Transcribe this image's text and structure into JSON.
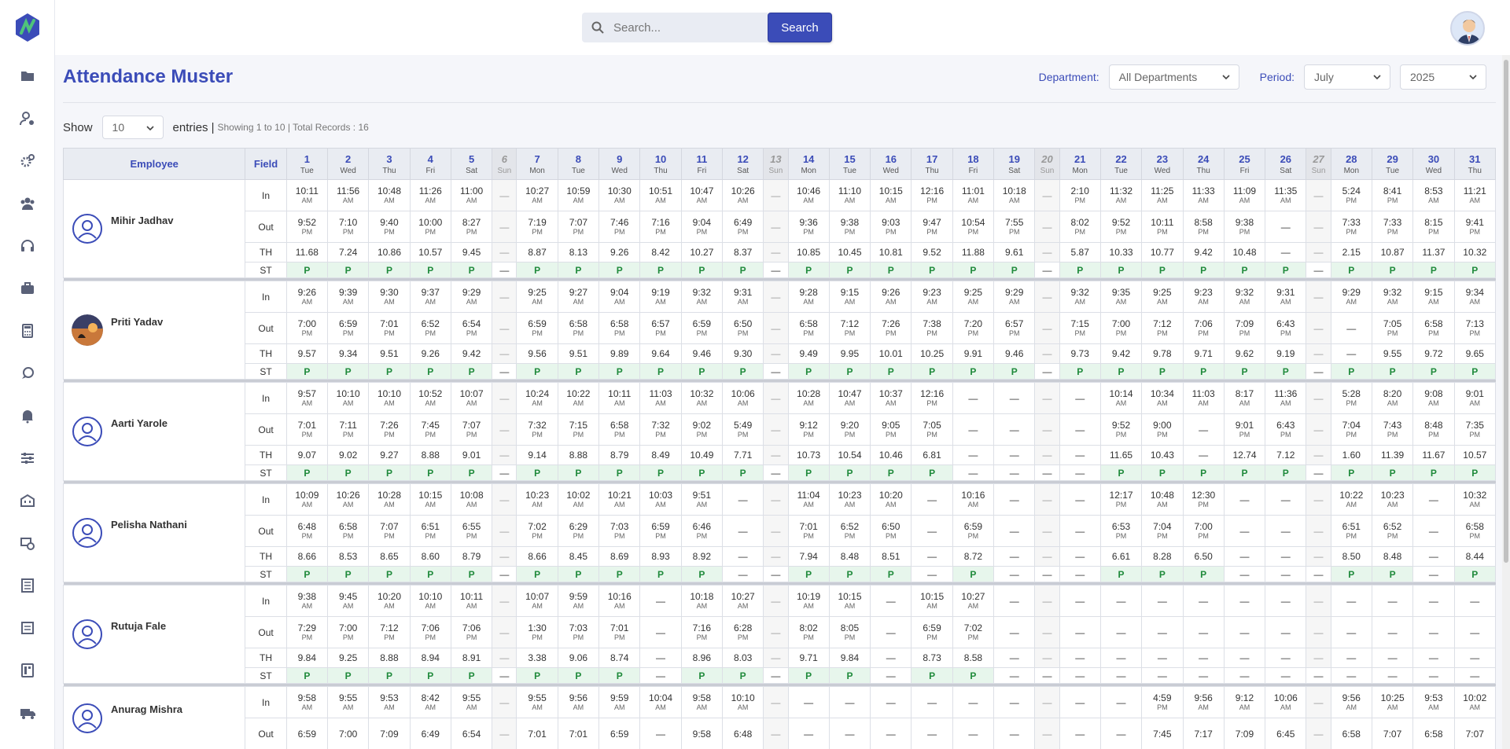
{
  "search": {
    "placeholder": "Search...",
    "button": "Search"
  },
  "page": {
    "title": "Attendance Muster"
  },
  "filters": {
    "department_label": "Department:",
    "department_value": "All Departments",
    "period_label": "Period:",
    "month": "July",
    "year": "2025"
  },
  "entries": {
    "show": "Show",
    "size": "10",
    "entries": "entries",
    "sep": "|",
    "summary": "Showing 1 to 10 | Total Records : 16"
  },
  "table": {
    "employee_header": "Employee",
    "field_header": "Field",
    "days": [
      {
        "n": "1",
        "w": "Tue"
      },
      {
        "n": "2",
        "w": "Wed"
      },
      {
        "n": "3",
        "w": "Thu"
      },
      {
        "n": "4",
        "w": "Fri"
      },
      {
        "n": "5",
        "w": "Sat"
      },
      {
        "n": "6",
        "w": "Sun"
      },
      {
        "n": "7",
        "w": "Mon"
      },
      {
        "n": "8",
        "w": "Tue"
      },
      {
        "n": "9",
        "w": "Wed"
      },
      {
        "n": "10",
        "w": "Thu"
      },
      {
        "n": "11",
        "w": "Fri"
      },
      {
        "n": "12",
        "w": "Sat"
      },
      {
        "n": "13",
        "w": "Sun"
      },
      {
        "n": "14",
        "w": "Mon"
      },
      {
        "n": "15",
        "w": "Tue"
      },
      {
        "n": "16",
        "w": "Wed"
      },
      {
        "n": "17",
        "w": "Thu"
      },
      {
        "n": "18",
        "w": "Fri"
      },
      {
        "n": "19",
        "w": "Sat"
      },
      {
        "n": "20",
        "w": "Sun"
      },
      {
        "n": "21",
        "w": "Mon"
      },
      {
        "n": "22",
        "w": "Tue"
      },
      {
        "n": "23",
        "w": "Wed"
      },
      {
        "n": "24",
        "w": "Thu"
      },
      {
        "n": "25",
        "w": "Fri"
      },
      {
        "n": "26",
        "w": "Sat"
      },
      {
        "n": "27",
        "w": "Sun"
      },
      {
        "n": "28",
        "w": "Mon"
      },
      {
        "n": "29",
        "w": "Tue"
      },
      {
        "n": "30",
        "w": "Wed"
      },
      {
        "n": "31",
        "w": "Thu"
      }
    ],
    "fields": [
      "In",
      "Out",
      "TH",
      "ST"
    ],
    "employees": [
      {
        "name": "Mihir Jadhav",
        "photo": false,
        "in": [
          "10:11 AM",
          "11:56 AM",
          "10:48 AM",
          "11:26 AM",
          "11:00 AM",
          "—",
          "10:27 AM",
          "10:59 AM",
          "10:30 AM",
          "10:51 AM",
          "10:47 AM",
          "10:26 AM",
          "—",
          "10:46 AM",
          "11:10 AM",
          "10:15 AM",
          "12:16 PM",
          "11:01 AM",
          "10:18 AM",
          "—",
          "2:10 PM",
          "11:32 AM",
          "11:25 AM",
          "11:33 AM",
          "11:09 AM",
          "11:35 AM",
          "—",
          "5:24 PM",
          "8:41 PM",
          "8:53 AM",
          "11:21 AM"
        ],
        "out": [
          "9:52 PM",
          "7:10 PM",
          "9:40 PM",
          "10:00 PM",
          "8:27 PM",
          "—",
          "7:19 PM",
          "7:07 PM",
          "7:46 PM",
          "7:16 PM",
          "9:04 PM",
          "6:49 PM",
          "—",
          "9:36 PM",
          "9:38 PM",
          "9:03 PM",
          "9:47 PM",
          "10:54 PM",
          "7:55 PM",
          "—",
          "8:02 PM",
          "9:52 PM",
          "10:11 PM",
          "8:58 PM",
          "9:38 PM",
          "—",
          "—",
          "7:33 PM",
          "7:33 PM",
          "8:15 PM",
          "9:41 PM"
        ],
        "th": [
          "11.68",
          "7.24",
          "10.86",
          "10.57",
          "9.45",
          "—",
          "8.87",
          "8.13",
          "9.26",
          "8.42",
          "10.27",
          "8.37",
          "—",
          "10.85",
          "10.45",
          "10.81",
          "9.52",
          "11.88",
          "9.61",
          "—",
          "5.87",
          "10.33",
          "10.77",
          "9.42",
          "10.48",
          "—",
          "—",
          "2.15",
          "10.87",
          "11.37",
          "10.32"
        ],
        "st": [
          "P",
          "P",
          "P",
          "P",
          "P",
          "—",
          "P",
          "P",
          "P",
          "P",
          "P",
          "P",
          "—",
          "P",
          "P",
          "P",
          "P",
          "P",
          "P",
          "—",
          "P",
          "P",
          "P",
          "P",
          "P",
          "P",
          "—",
          "P",
          "P",
          "P",
          "P"
        ]
      },
      {
        "name": "Priti Yadav",
        "photo": true,
        "in": [
          "9:26 AM",
          "9:39 AM",
          "9:30 AM",
          "9:37 AM",
          "9:29 AM",
          "—",
          "9:25 AM",
          "9:27 AM",
          "9:04 AM",
          "9:19 AM",
          "9:32 AM",
          "9:31 AM",
          "—",
          "9:28 AM",
          "9:15 AM",
          "9:26 AM",
          "9:23 AM",
          "9:25 AM",
          "9:29 AM",
          "—",
          "9:32 AM",
          "9:35 AM",
          "9:25 AM",
          "9:23 AM",
          "9:32 AM",
          "9:31 AM",
          "—",
          "9:29 AM",
          "9:32 AM",
          "9:15 AM",
          "9:34 AM"
        ],
        "out": [
          "7:00 PM",
          "6:59 PM",
          "7:01 PM",
          "6:52 PM",
          "6:54 PM",
          "—",
          "6:59 PM",
          "6:58 PM",
          "6:58 PM",
          "6:57 PM",
          "6:59 PM",
          "6:50 PM",
          "—",
          "6:58 PM",
          "7:12 PM",
          "7:26 PM",
          "7:38 PM",
          "7:20 PM",
          "6:57 PM",
          "—",
          "7:15 PM",
          "7:00 PM",
          "7:12 PM",
          "7:06 PM",
          "7:09 PM",
          "6:43 PM",
          "—",
          "—",
          "7:05 PM",
          "6:58 PM",
          "7:13 PM"
        ],
        "th": [
          "9.57",
          "9.34",
          "9.51",
          "9.26",
          "9.42",
          "—",
          "9.56",
          "9.51",
          "9.89",
          "9.64",
          "9.46",
          "9.30",
          "—",
          "9.49",
          "9.95",
          "10.01",
          "10.25",
          "9.91",
          "9.46",
          "—",
          "9.73",
          "9.42",
          "9.78",
          "9.71",
          "9.62",
          "9.19",
          "—",
          "—",
          "9.55",
          "9.72",
          "9.65"
        ],
        "st": [
          "P",
          "P",
          "P",
          "P",
          "P",
          "—",
          "P",
          "P",
          "P",
          "P",
          "P",
          "P",
          "—",
          "P",
          "P",
          "P",
          "P",
          "P",
          "P",
          "—",
          "P",
          "P",
          "P",
          "P",
          "P",
          "P",
          "—",
          "P",
          "P",
          "P",
          "P"
        ]
      },
      {
        "name": "Aarti Yarole",
        "photo": false,
        "in": [
          "9:57 AM",
          "10:10 AM",
          "10:10 AM",
          "10:52 AM",
          "10:07 AM",
          "—",
          "10:24 AM",
          "10:22 AM",
          "10:11 AM",
          "11:03 AM",
          "10:32 AM",
          "10:06 AM",
          "—",
          "10:28 AM",
          "10:47 AM",
          "10:37 AM",
          "12:16 PM",
          "—",
          "—",
          "—",
          "—",
          "10:14 AM",
          "10:34 AM",
          "11:03 AM",
          "8:17 AM",
          "11:36 AM",
          "—",
          "5:28 PM",
          "8:20 AM",
          "9:08 AM",
          "9:01 AM"
        ],
        "out": [
          "7:01 PM",
          "7:11 PM",
          "7:26 PM",
          "7:45 PM",
          "7:07 PM",
          "—",
          "7:32 PM",
          "7:15 PM",
          "6:58 PM",
          "7:32 PM",
          "9:02 PM",
          "5:49 PM",
          "—",
          "9:12 PM",
          "9:20 PM",
          "9:05 PM",
          "7:05 PM",
          "—",
          "—",
          "—",
          "—",
          "9:52 PM",
          "9:00 PM",
          "—",
          "9:01 PM",
          "6:43 PM",
          "—",
          "7:04 PM",
          "7:43 PM",
          "8:48 PM",
          "7:35 PM"
        ],
        "th": [
          "9.07",
          "9.02",
          "9.27",
          "8.88",
          "9.01",
          "—",
          "9.14",
          "8.88",
          "8.79",
          "8.49",
          "10.49",
          "7.71",
          "—",
          "10.73",
          "10.54",
          "10.46",
          "6.81",
          "—",
          "—",
          "—",
          "—",
          "11.65",
          "10.43",
          "—",
          "12.74",
          "7.12",
          "—",
          "1.60",
          "11.39",
          "11.67",
          "10.57"
        ],
        "st": [
          "P",
          "P",
          "P",
          "P",
          "P",
          "—",
          "P",
          "P",
          "P",
          "P",
          "P",
          "P",
          "—",
          "P",
          "P",
          "P",
          "P",
          "—",
          "—",
          "—",
          "—",
          "P",
          "P",
          "P",
          "P",
          "P",
          "—",
          "P",
          "P",
          "P",
          "P"
        ]
      },
      {
        "name": "Pelisha Nathani",
        "photo": false,
        "in": [
          "10:09 AM",
          "10:26 AM",
          "10:28 AM",
          "10:15 AM",
          "10:08 AM",
          "—",
          "10:23 AM",
          "10:02 AM",
          "10:21 AM",
          "10:03 AM",
          "9:51 AM",
          "—",
          "—",
          "11:04 AM",
          "10:23 AM",
          "10:20 AM",
          "—",
          "10:16 AM",
          "—",
          "—",
          "—",
          "12:17 PM",
          "10:48 AM",
          "12:30 PM",
          "—",
          "—",
          "—",
          "10:22 AM",
          "10:23 AM",
          "—",
          "10:32 AM"
        ],
        "out": [
          "6:48 PM",
          "6:58 PM",
          "7:07 PM",
          "6:51 PM",
          "6:55 PM",
          "—",
          "7:02 PM",
          "6:29 PM",
          "7:03 PM",
          "6:59 PM",
          "6:46 PM",
          "—",
          "—",
          "7:01 PM",
          "6:52 PM",
          "6:50 PM",
          "—",
          "6:59 PM",
          "—",
          "—",
          "—",
          "6:53 PM",
          "7:04 PM",
          "7:00 PM",
          "—",
          "—",
          "—",
          "6:51 PM",
          "6:52 PM",
          "—",
          "6:58 PM"
        ],
        "th": [
          "8.66",
          "8.53",
          "8.65",
          "8.60",
          "8.79",
          "—",
          "8.66",
          "8.45",
          "8.69",
          "8.93",
          "8.92",
          "—",
          "—",
          "7.94",
          "8.48",
          "8.51",
          "—",
          "8.72",
          "—",
          "—",
          "—",
          "6.61",
          "8.28",
          "6.50",
          "—",
          "—",
          "—",
          "8.50",
          "8.48",
          "—",
          "8.44"
        ],
        "st": [
          "P",
          "P",
          "P",
          "P",
          "P",
          "—",
          "P",
          "P",
          "P",
          "P",
          "P",
          "—",
          "—",
          "P",
          "P",
          "P",
          "—",
          "P",
          "—",
          "—",
          "—",
          "P",
          "P",
          "P",
          "—",
          "—",
          "—",
          "P",
          "P",
          "—",
          "P"
        ]
      },
      {
        "name": "Rutuja Fale",
        "photo": false,
        "in": [
          "9:38 AM",
          "9:45 AM",
          "10:20 AM",
          "10:10 AM",
          "10:11 AM",
          "—",
          "10:07 AM",
          "9:59 AM",
          "10:16 AM",
          "—",
          "10:18 AM",
          "10:27 AM",
          "—",
          "10:19 AM",
          "10:15 AM",
          "—",
          "10:15 AM",
          "10:27 AM",
          "—",
          "—",
          "—",
          "—",
          "—",
          "—",
          "—",
          "—",
          "—",
          "—",
          "—",
          "—",
          "—"
        ],
        "out": [
          "7:29 PM",
          "7:00 PM",
          "7:12 PM",
          "7:06 PM",
          "7:06 PM",
          "—",
          "1:30 PM",
          "7:03 PM",
          "7:01 PM",
          "—",
          "7:16 PM",
          "6:28 PM",
          "—",
          "8:02 PM",
          "8:05 PM",
          "—",
          "6:59 PM",
          "7:02 PM",
          "—",
          "—",
          "—",
          "—",
          "—",
          "—",
          "—",
          "—",
          "—",
          "—",
          "—",
          "—",
          "—"
        ],
        "th": [
          "9.84",
          "9.25",
          "8.88",
          "8.94",
          "8.91",
          "—",
          "3.38",
          "9.06",
          "8.74",
          "—",
          "8.96",
          "8.03",
          "—",
          "9.71",
          "9.84",
          "—",
          "8.73",
          "8.58",
          "—",
          "—",
          "—",
          "—",
          "—",
          "—",
          "—",
          "—",
          "—",
          "—",
          "—",
          "—",
          "—"
        ],
        "st": [
          "P",
          "P",
          "P",
          "P",
          "P",
          "—",
          "P",
          "P",
          "P",
          "—",
          "P",
          "P",
          "—",
          "P",
          "P",
          "—",
          "P",
          "P",
          "—",
          "—",
          "—",
          "—",
          "—",
          "—",
          "—",
          "—",
          "—",
          "—",
          "—",
          "—",
          "—"
        ]
      },
      {
        "name": "Anurag Mishra",
        "photo": false,
        "in": [
          "9:58 AM",
          "9:55 AM",
          "9:53 AM",
          "8:42 AM",
          "9:55 AM",
          "—",
          "9:55 AM",
          "9:56 AM",
          "9:59 AM",
          "10:04 AM",
          "9:58 AM",
          "10:10 AM",
          "—",
          "—",
          "—",
          "—",
          "—",
          "—",
          "—",
          "—",
          "—",
          "—",
          "4:59 PM",
          "9:56 AM",
          "9:12 AM",
          "10:06 AM",
          "—",
          "9:56 AM",
          "10:25 AM",
          "9:53 AM",
          "10:02 AM"
        ],
        "out": [
          "6:59",
          "7:00",
          "7:09",
          "6:49",
          "6:54",
          "—",
          "7:01",
          "7:01",
          "6:59",
          "—",
          "9:58",
          "6:48",
          "—",
          "—",
          "—",
          "—",
          "—",
          "—",
          "—",
          "—",
          "—",
          "—",
          "7:45",
          "7:17",
          "7:09",
          "6:45",
          "—",
          "6:58",
          "7:07",
          "6:58",
          "7:07"
        ],
        "th": [],
        "st": []
      }
    ]
  }
}
